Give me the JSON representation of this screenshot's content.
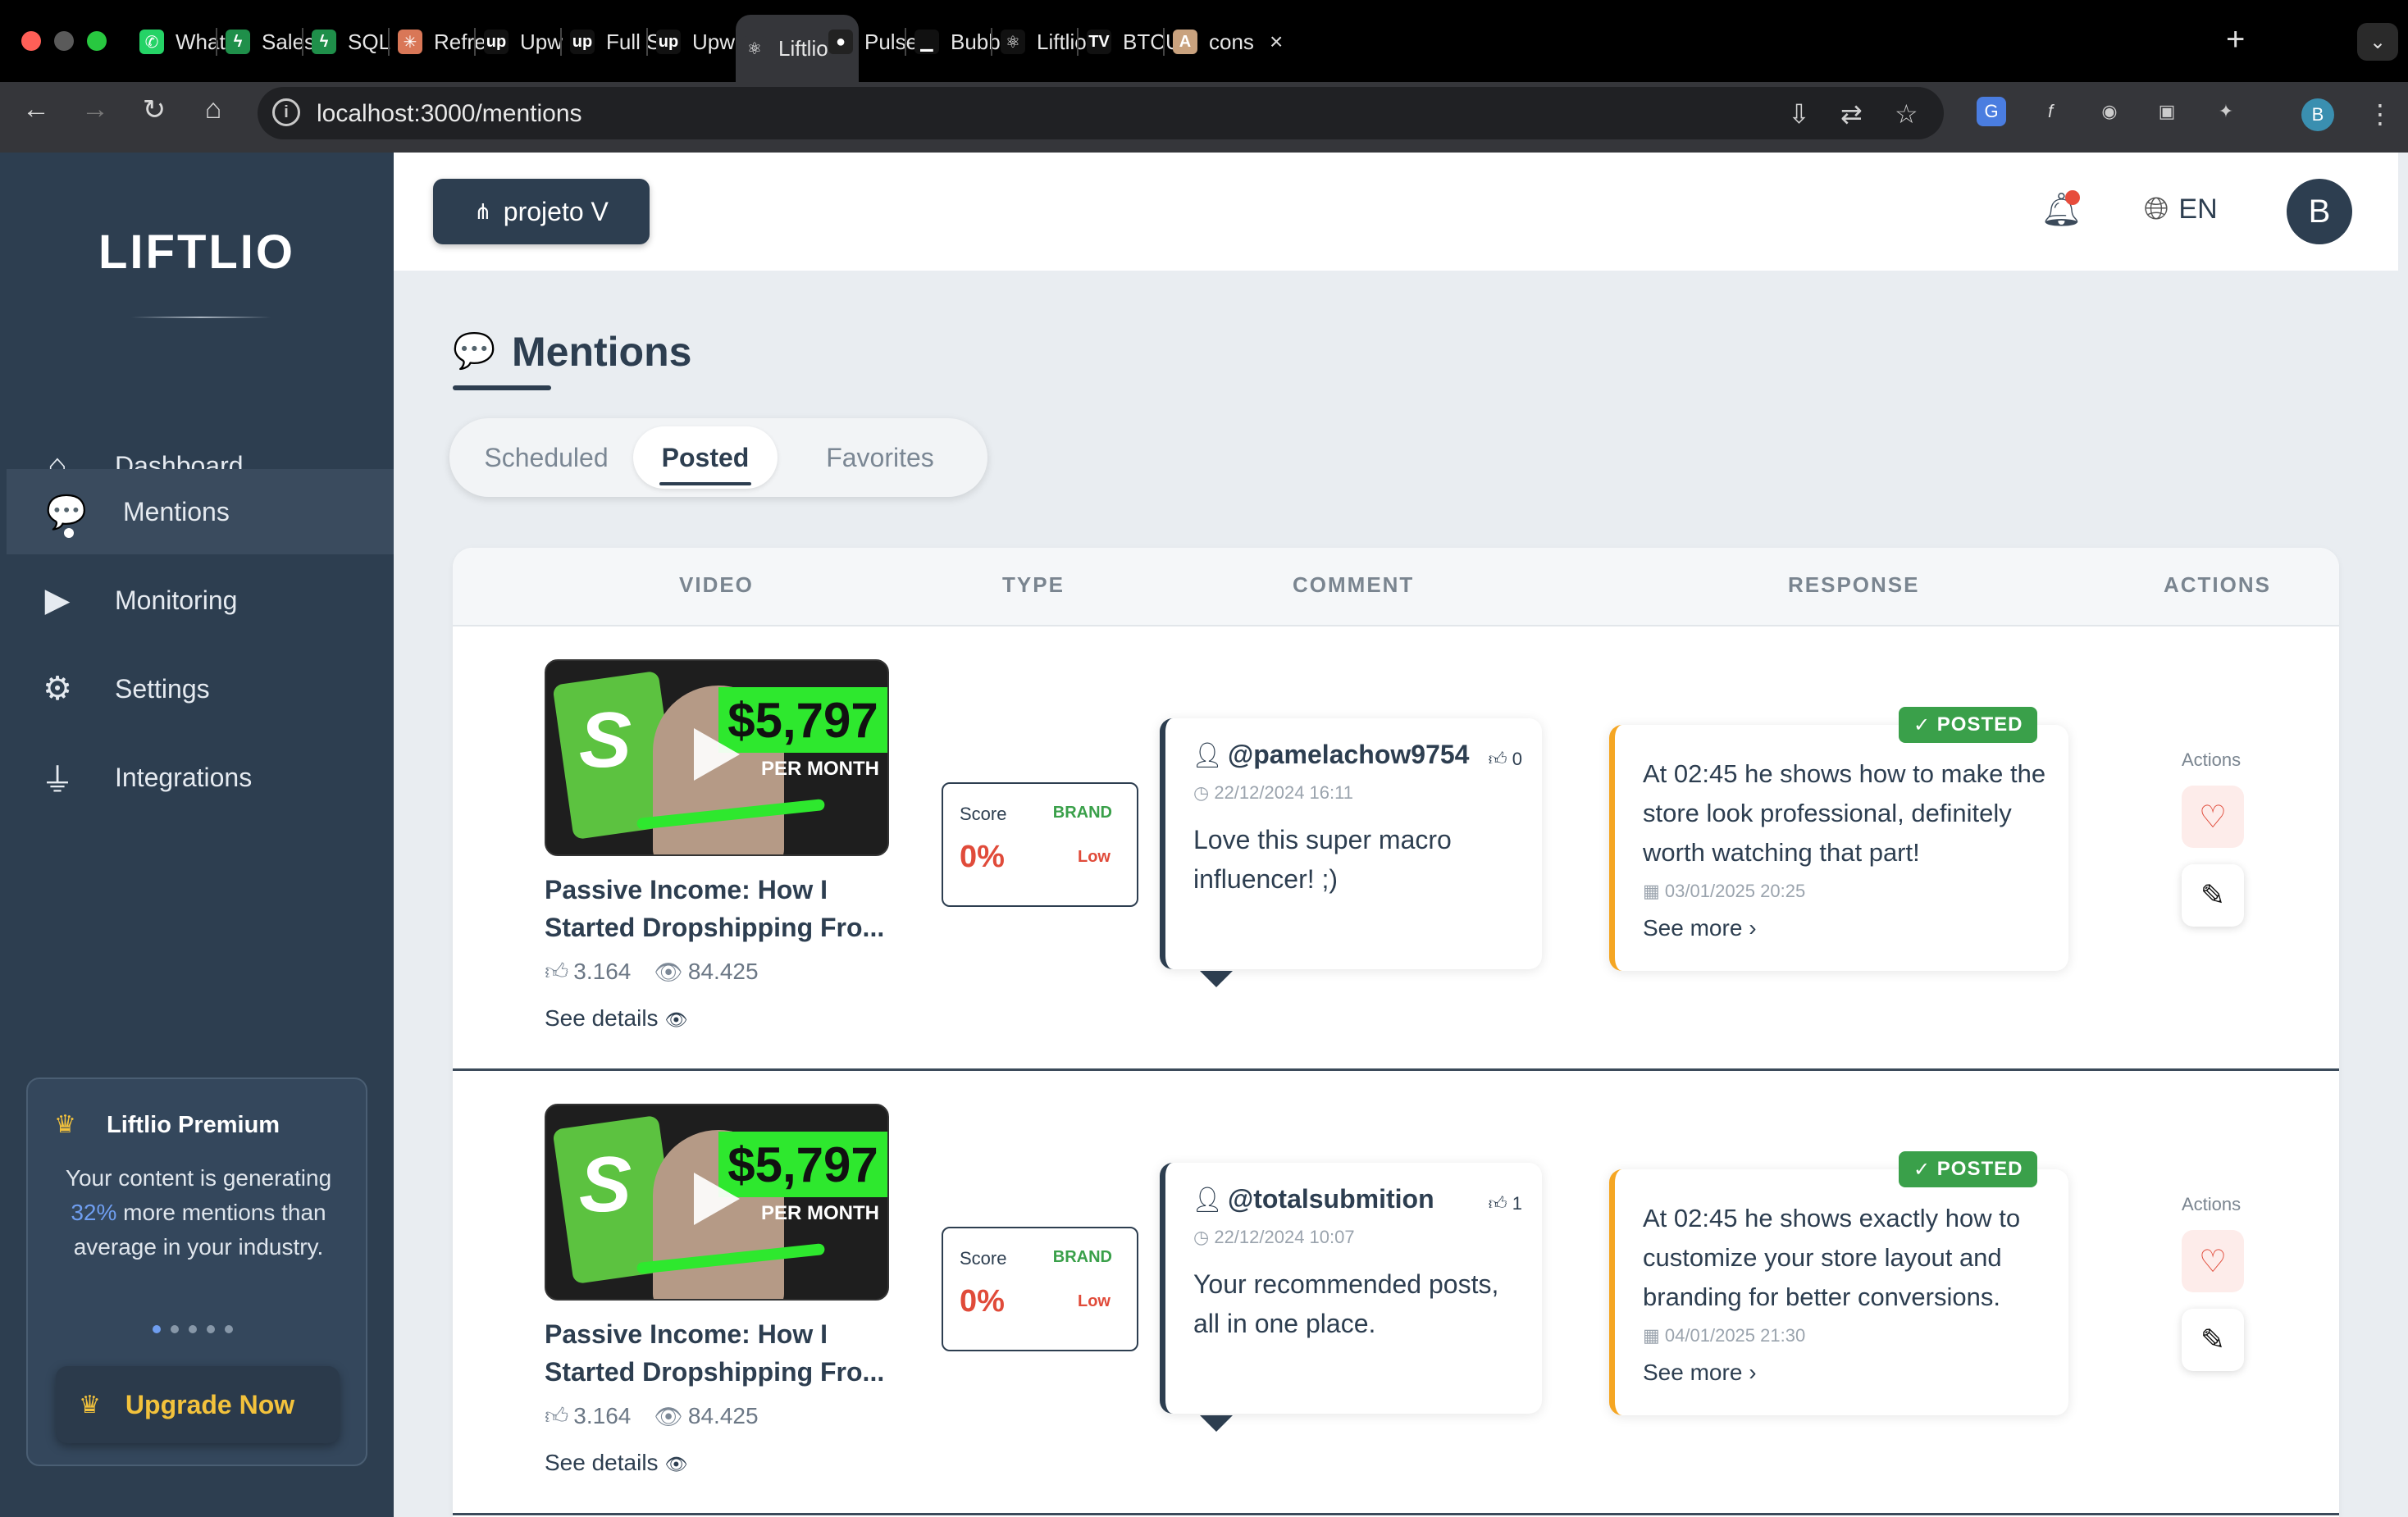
{
  "browser": {
    "tabs": [
      {
        "title": "What",
        "favicon": "whatsapp-icon",
        "color": "#25d366",
        "glyph": "✆"
      },
      {
        "title": "Sales",
        "favicon": "bolt-icon",
        "color": "#1f8f4a",
        "glyph": "ϟ"
      },
      {
        "title": "SQL",
        "favicon": "bolt-icon",
        "color": "#1f8f4a",
        "glyph": "ϟ"
      },
      {
        "title": "Refre",
        "favicon": "asterisk-icon",
        "color": "#d97757",
        "glyph": "✳"
      },
      {
        "title": "Upw",
        "favicon": "upwork-icon",
        "color": "#111",
        "glyph": "up"
      },
      {
        "title": "Full S",
        "favicon": "upwork-icon",
        "color": "#111",
        "glyph": "up"
      },
      {
        "title": "Upw",
        "favicon": "upwork-icon",
        "color": "#111",
        "glyph": "up"
      },
      {
        "title": "Liftlio",
        "favicon": "react-icon",
        "color": "#35363a",
        "glyph": "⚛"
      },
      {
        "title": "Pulse",
        "favicon": "github-icon",
        "color": "#222",
        "glyph": "●"
      },
      {
        "title": "Bubb",
        "favicon": "chart-icon",
        "color": "#111",
        "glyph": "▁"
      },
      {
        "title": "Liftlio",
        "favicon": "react-icon",
        "color": "#111",
        "glyph": "⚛"
      },
      {
        "title": "BTCU",
        "favicon": "tradingview-icon",
        "color": "#111",
        "glyph": "TV"
      },
      {
        "title": "cons",
        "favicon": "anthropic-icon",
        "color": "#c9a27e",
        "glyph": "A"
      }
    ],
    "url": "localhost:3000/mentions"
  },
  "sidebar": {
    "logo": "LIFTLIO",
    "items": [
      {
        "label": "Dashboard",
        "icon": "home-icon"
      },
      {
        "label": "Mentions",
        "icon": "comments-icon"
      },
      {
        "label": "Monitoring",
        "icon": "youtube-icon"
      },
      {
        "label": "Settings",
        "icon": "gear-icon"
      },
      {
        "label": "Integrations",
        "icon": "plug-icon"
      }
    ],
    "premium": {
      "title": "Liftlio Premium",
      "text_before": "Your content is generating",
      "percent": "32%",
      "text_after": "more mentions than average in your industry.",
      "button": "Upgrade Now"
    }
  },
  "header": {
    "project": "projeto V",
    "language": "EN",
    "avatar_letter": "B"
  },
  "page": {
    "title": "Mentions",
    "tabs": [
      "Scheduled",
      "Posted",
      "Favorites"
    ],
    "active_tab": "Posted"
  },
  "table": {
    "columns": [
      "VIDEO",
      "TYPE",
      "COMMENT",
      "RESPONSE",
      "ACTIONS"
    ],
    "rows": [
      {
        "thumb_price": "$5,797",
        "thumb_sub": "PER MONTH",
        "video_title": "Passive Income: How I Started Dropshipping Fro...",
        "likes": "3.164",
        "views": "84.425",
        "see_details": "See details",
        "type_score_label": "Score",
        "type_kind": "BRAND",
        "type_score": "0%",
        "type_level": "Low",
        "comment_user": "@pamelachow9754",
        "comment_likes": "0",
        "comment_date": "22/12/2024 16:11",
        "comment_text": "Love this super macro influencer! ;)",
        "status": "POSTED",
        "response_text": "At 02:45 he shows how to make the store look professional, definitely worth watching that part!",
        "response_date": "03/01/2025 20:25",
        "see_more": "See more",
        "actions_label": "Actions"
      },
      {
        "thumb_price": "$5,797",
        "thumb_sub": "PER MONTH",
        "video_title": "Passive Income: How I Started Dropshipping Fro...",
        "likes": "3.164",
        "views": "84.425",
        "see_details": "See details",
        "type_score_label": "Score",
        "type_kind": "BRAND",
        "type_score": "0%",
        "type_level": "Low",
        "comment_user": "@totalsubmition",
        "comment_likes": "1",
        "comment_date": "22/12/2024 10:07",
        "comment_text": "Your recommended posts, all in one place.",
        "status": "POSTED",
        "response_text": "At 02:45 he shows exactly how to customize your store layout and branding for better conversions.",
        "response_date": "04/01/2025 21:30",
        "see_more": "See more",
        "actions_label": "Actions"
      }
    ]
  }
}
